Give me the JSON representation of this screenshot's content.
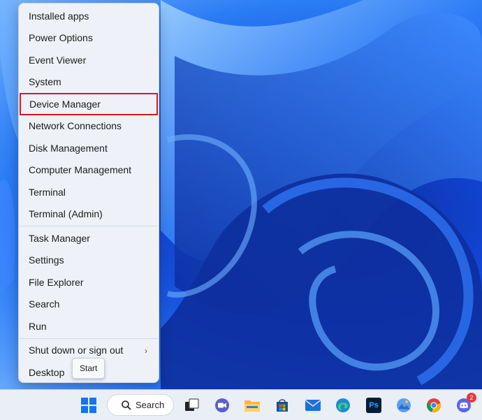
{
  "menu": {
    "group1": [
      "Installed apps",
      "Power Options",
      "Event Viewer",
      "System",
      "Device Manager",
      "Network Connections",
      "Disk Management",
      "Computer Management",
      "Terminal",
      "Terminal (Admin)"
    ],
    "group2": [
      "Task Manager",
      "Settings",
      "File Explorer",
      "Search",
      "Run"
    ],
    "group3": [
      "Shut down or sign out",
      "Desktop"
    ],
    "highlighted": "Device Manager"
  },
  "tooltip": {
    "start": "Start"
  },
  "taskbar": {
    "search_label": "Search",
    "apps": [
      "windows-start-icon",
      "task-view-icon",
      "video-chat-icon",
      "file-explorer-icon",
      "microsoft-store-icon",
      "mail-icon",
      "edge-icon",
      "photoshop-icon",
      "photos-icon",
      "chrome-icon",
      "discord-icon"
    ],
    "photoshop_label": "Ps",
    "discord_badge": "2"
  },
  "colors": {
    "highlight_border": "#e0161c",
    "wallpaper": "#1246d6"
  }
}
